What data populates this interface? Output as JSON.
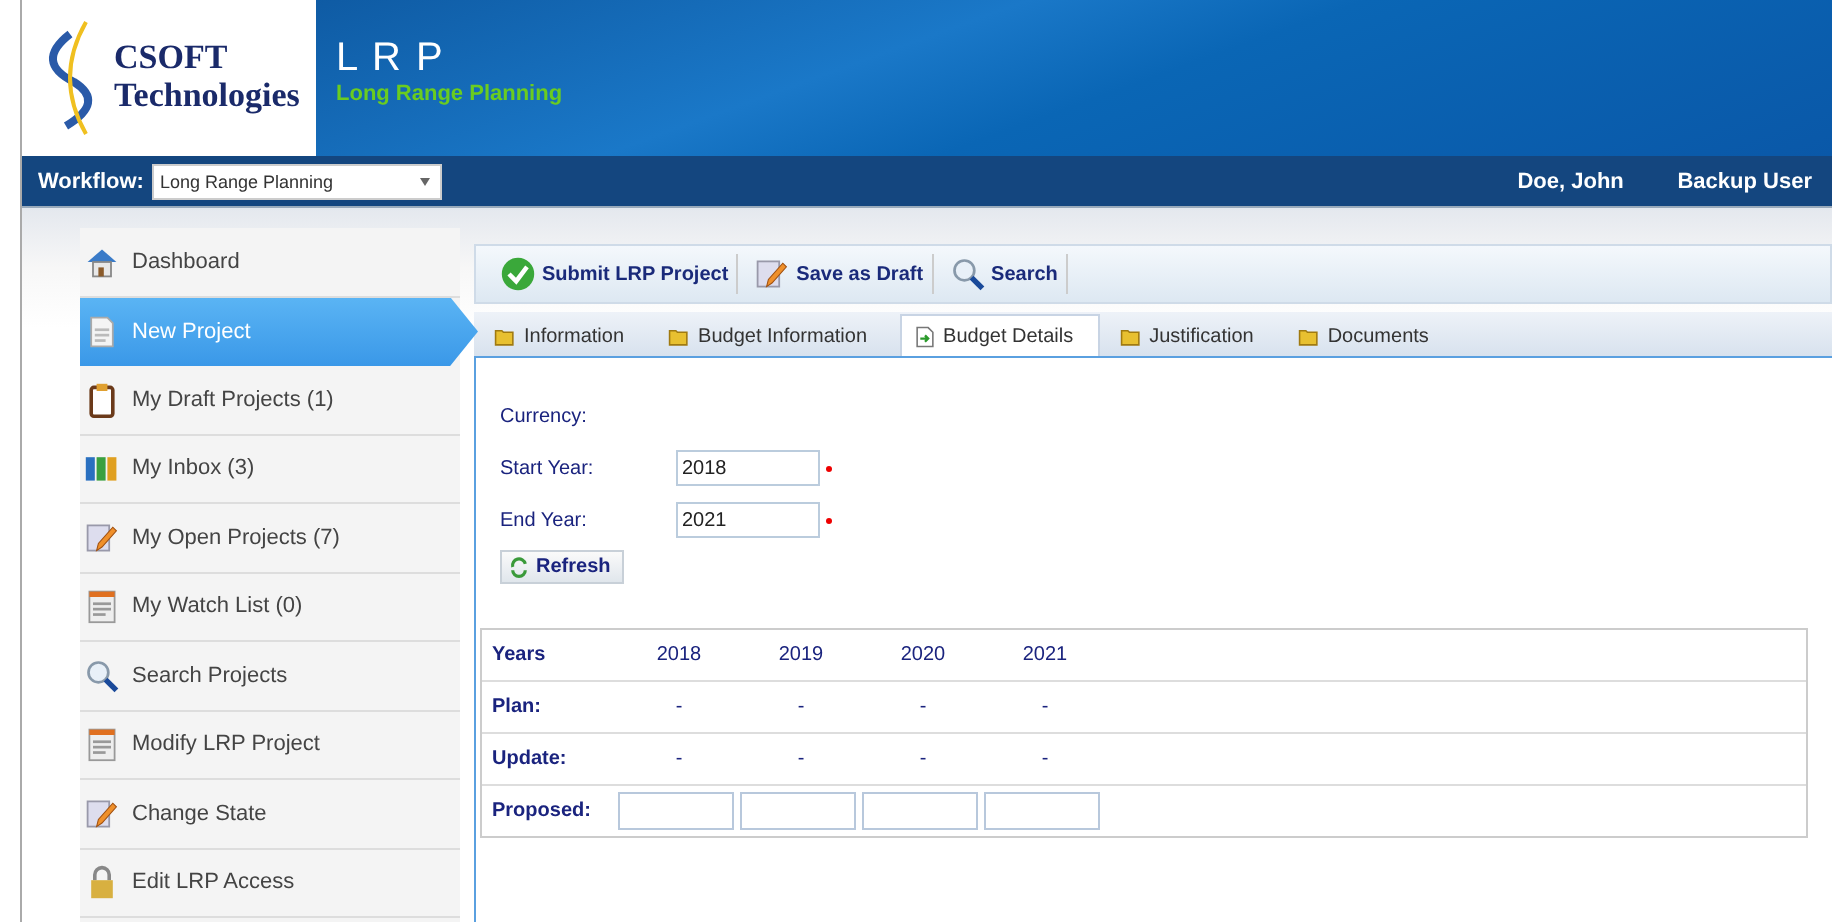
{
  "logo": {
    "line1": "CSOFT",
    "line2": "Technologies"
  },
  "app": {
    "title": "L R P",
    "subtitle": "Long Range Planning"
  },
  "workflow": {
    "label": "Workflow:",
    "value": "Long Range Planning"
  },
  "user": {
    "name": "Doe, John",
    "role": "Backup User"
  },
  "sidebar": {
    "items": [
      {
        "label": "Dashboard",
        "kind": "house",
        "selected": false
      },
      {
        "label": "New Project",
        "kind": "document",
        "selected": true
      },
      {
        "label": "My Draft Projects (1)",
        "kind": "clipboard",
        "selected": false
      },
      {
        "label": "My Inbox (3)",
        "kind": "binders",
        "selected": false
      },
      {
        "label": "My Open Projects (7)",
        "kind": "pencil",
        "selected": false
      },
      {
        "label": "My Watch List (0)",
        "kind": "list",
        "selected": false
      },
      {
        "label": "Search Projects",
        "kind": "search",
        "selected": false
      },
      {
        "label": "Modify LRP Project",
        "kind": "list",
        "selected": false
      },
      {
        "label": "Change State",
        "kind": "pencil",
        "selected": false
      },
      {
        "label": "Edit LRP Access",
        "kind": "lock",
        "selected": false
      }
    ]
  },
  "toolbar": [
    {
      "label": "Submit LRP Project",
      "kind": "check"
    },
    {
      "label": "Save as Draft",
      "kind": "pencil"
    },
    {
      "label": "Search",
      "kind": "search"
    }
  ],
  "tabs": [
    {
      "label": "Information",
      "selected": false
    },
    {
      "label": "Budget Information",
      "selected": false
    },
    {
      "label": "Budget Details",
      "selected": true
    },
    {
      "label": "Justification",
      "selected": false
    },
    {
      "label": "Documents",
      "selected": false
    }
  ],
  "form": {
    "currency_label": "Currency:",
    "start_label": "Start Year:",
    "start_value": "2018",
    "end_label": "End Year:",
    "end_value": "2021",
    "refresh": "Refresh"
  },
  "table": {
    "header": "Years",
    "years": [
      "2018",
      "2019",
      "2020",
      "2021"
    ],
    "rows": [
      {
        "label": "Plan:",
        "kind": "text",
        "values": [
          "-",
          "-",
          "-",
          "-"
        ]
      },
      {
        "label": "Update:",
        "kind": "text",
        "values": [
          "-",
          "-",
          "-",
          "-"
        ]
      },
      {
        "label": "Proposed:",
        "kind": "input"
      }
    ]
  }
}
